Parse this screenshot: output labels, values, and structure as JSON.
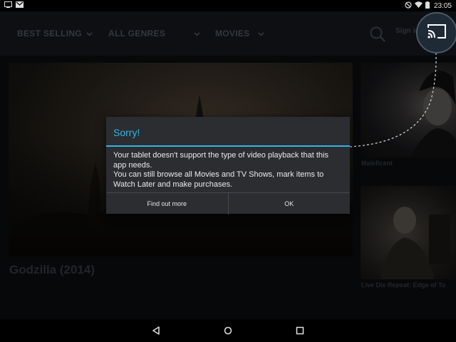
{
  "status_bar": {
    "left_icons": [
      "screen-icon",
      "gmail-icon"
    ],
    "right_icons": [
      "do-not-disturb-icon",
      "wifi-icon",
      "battery-icon"
    ],
    "time": "23:05"
  },
  "header": {
    "filters": [
      {
        "label": "BEST SELLING"
      },
      {
        "label": "ALL GENRES"
      },
      {
        "label": "MOVIES"
      }
    ],
    "sign_in": "Sign in"
  },
  "content": {
    "featured_title": "Godzilla (2014)",
    "tiles": [
      {
        "caption": "Maleficent"
      },
      {
        "caption": "Live Die Repeat: Edge of To"
      }
    ]
  },
  "dialog": {
    "title": "Sorry!",
    "message_lines": [
      "Your tablet doesn't support the type of video playback that this",
      "app needs.",
      "You can still browse all Movies and TV Shows, mark items to",
      "Watch Later and make purchases."
    ],
    "buttons": {
      "find_out_more": "Find out more",
      "ok": "OK"
    }
  },
  "colors": {
    "accent": "#33b5e5",
    "dialog_bg": "#2b2d31",
    "header_bg": "#191d24"
  },
  "nav_bar": [
    "back-icon",
    "home-icon",
    "recents-icon"
  ]
}
